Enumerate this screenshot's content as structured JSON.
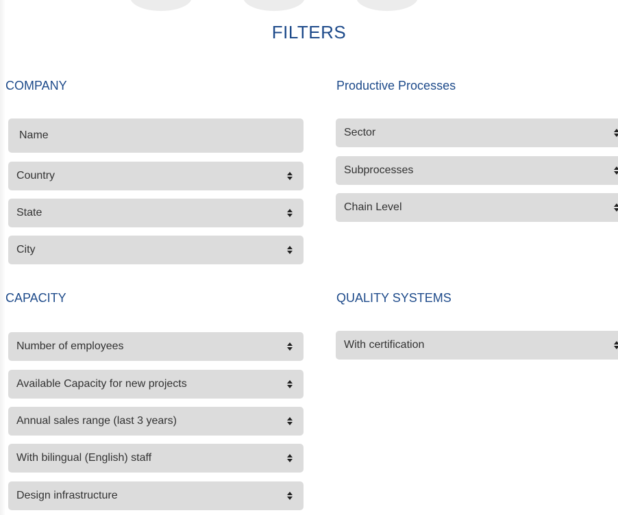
{
  "header": {
    "title": "FILTERS"
  },
  "company": {
    "title": "COMPANY",
    "name_placeholder": "Name",
    "country": "Country",
    "state": "State",
    "city": "City"
  },
  "productive": {
    "title": "Productive Processes",
    "sector": "Sector",
    "subprocesses": "Subprocesses",
    "chain_level": "Chain Level"
  },
  "capacity": {
    "title": "CAPACITY",
    "employees": "Number of employees",
    "available": "Available Capacity for new projects",
    "annual_sales": "Annual sales range (last 3 years)",
    "bilingual": "With bilingual (English) staff",
    "design": "Design infrastructure"
  },
  "quality": {
    "title": "QUALITY SYSTEMS",
    "certification": "With certification"
  }
}
